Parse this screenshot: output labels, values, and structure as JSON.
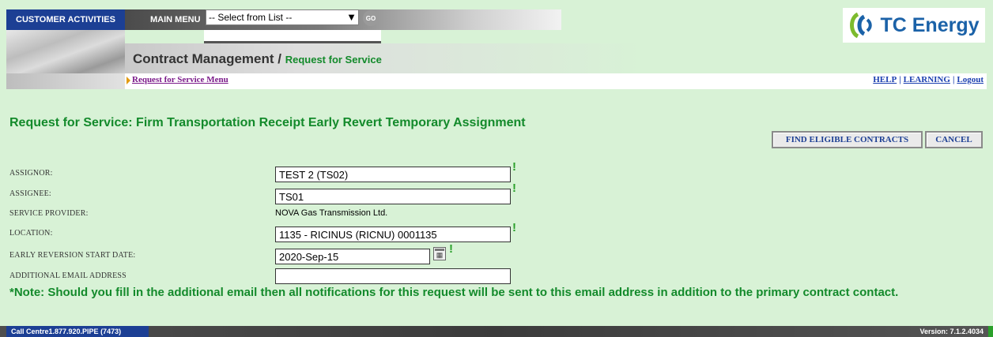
{
  "header": {
    "customer_activities": "CUSTOMER ACTIVITIES",
    "main_menu_label": "MAIN MENU",
    "menu_select_value": "-- Select from List --",
    "go_label": "GO",
    "title_main": "Contract Management /",
    "title_sub": "Request for Service",
    "logo_text": "TC Energy",
    "logo_color": "#1b62a8"
  },
  "breadcrumb": {
    "link": "Request for Service Menu",
    "help": "HELP",
    "learning": "LEARNING",
    "logout": "Logout",
    "separator": "|"
  },
  "page": {
    "heading": "Request for Service: Firm Transportation Receipt Early Revert Temporary Assignment",
    "find_button": "FIND ELIGIBLE CONTRACTS",
    "cancel_button": "CANCEL"
  },
  "form": {
    "assignor_label": "ASSIGNOR:",
    "assignor_value": "TEST 2 (TS02)",
    "assignee_label": "ASSIGNEE:",
    "assignee_value": "TS01",
    "provider_label": "SERVICE PROVIDER:",
    "provider_value": "NOVA Gas Transmission Ltd.",
    "location_label": "LOCATION:",
    "location_value": "1135 - RICINUS (RICNU) 0001135",
    "start_date_label": "EARLY REVERSION START DATE:",
    "start_date_value": "2020-Sep-15",
    "email_label": "ADDITIONAL EMAIL ADDRESS",
    "email_value": "",
    "required_mark": "!"
  },
  "note": "*Note: Should you fill in the additional email then all notifications for this request will be sent to this email address in addition to the primary contract contact.",
  "footer": {
    "call_centre": "Call Centre1.877.920.PIPE (7473)",
    "version": "Version: 7.1.2.4034"
  },
  "colors": {
    "background": "#d8f2d6",
    "accent_green": "#138a2b",
    "nav_blue": "#1c3f94"
  }
}
